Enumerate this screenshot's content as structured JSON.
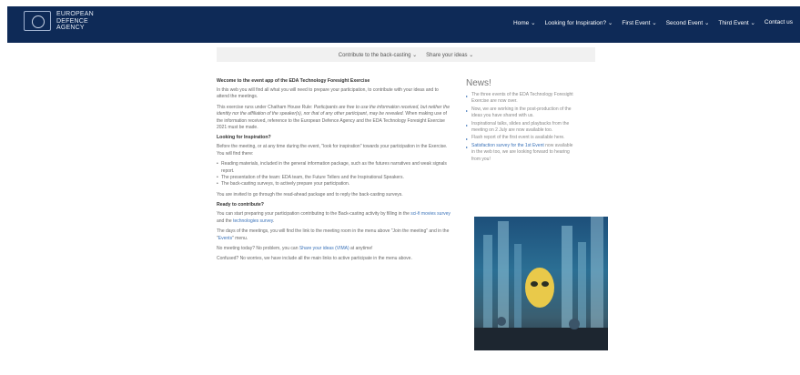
{
  "header": {
    "logo_lines": [
      "EUROPEAN",
      "DEFENCE",
      "AGENCY"
    ],
    "nav": [
      "Home ⌄",
      "Looking for Inspiration? ⌄",
      "First Event ⌄",
      "Second Event ⌄",
      "Third Event ⌄",
      "Contact us"
    ]
  },
  "subnav": [
    "Contribute to the back-casting ⌄",
    "Share your ideas ⌄"
  ],
  "main": {
    "welcome_heading": "Wecome to the event app of the EDA Technology Foresight Exercise",
    "intro": "In this web you will find all what you will need to prepare your participation, to contribute with your ideas and to attend the meetings.",
    "rule_1": "This exercise runs under Chatham House Rule:",
    "rule_italic": "Participants are free to use the information received, but neither the identity nor the affiliation of the speaker(s), nor that of any other participant, may be revealed.",
    "rule_2": "When making use of the information received, reference to the European Defence Agency and the EDA Technology Foresight Exercise 2021 must be made.",
    "looking_heading": "Looking for Inspiration?",
    "looking_text": "Before the meeting, or at any time during the event, \"look for inspiration\" towards your participation in the Exercise. You will find there:",
    "bullets": [
      "Reading materials, included in the general information package, such as the futures narratives and weak signals report.",
      "The presentation of the team: EDA team, the Future Tellers and the Inspirational Speakers.",
      "The back-casting surveys, to actively prepare your participation."
    ],
    "invited": "You are invited to go through the read-ahead package and to reply the back-casting surveys.",
    "ready_heading": "Ready to contribute?",
    "ready_a": "You can start preparing your participation contributing to the Back-casting activity by filling in the",
    "ready_link1": "sci-fi movies survey",
    "ready_b": "and the",
    "ready_link2": "technologies survey",
    "ready_c": ".",
    "days_a": "The days of the meetings, you will find the link to the meeting room in the menu above \"Join the meeting\" and in the \"",
    "days_link": "Events",
    "days_b": "\" menu.",
    "nomeet_a": "No meeting today? No problem, you can",
    "nomeet_link": "Share your ideas (VIMA)",
    "nomeet_b": "at anytime!",
    "confused": "Confused? No worries, we have include all the main links to active participate in the menu above."
  },
  "news": {
    "title": "News!",
    "items": [
      {
        "text": "The three events of the EDA Technology Foresight Exercise are now over.",
        "link": false
      },
      {
        "text": "Now, we are working in the post-production of the ideas you have shared with us.",
        "link": false
      },
      {
        "text": "Inspirational talks, slides and playbacks from the meeting on 2 July are now available too.",
        "link": false
      },
      {
        "text": "Flash report of the first event is available here.",
        "link": true
      },
      {
        "text": "Satisfaction survey for the 1st Event now available in the web too, we are looking forward to hearing from you!",
        "link": false,
        "lead_link": "Satisfaction survey for the 1st Event"
      }
    ]
  },
  "image": {
    "subject": "futuristic-city-mask-artwork",
    "colors": {
      "sky": "#2b6f94",
      "accent": "#e9c94a"
    }
  }
}
